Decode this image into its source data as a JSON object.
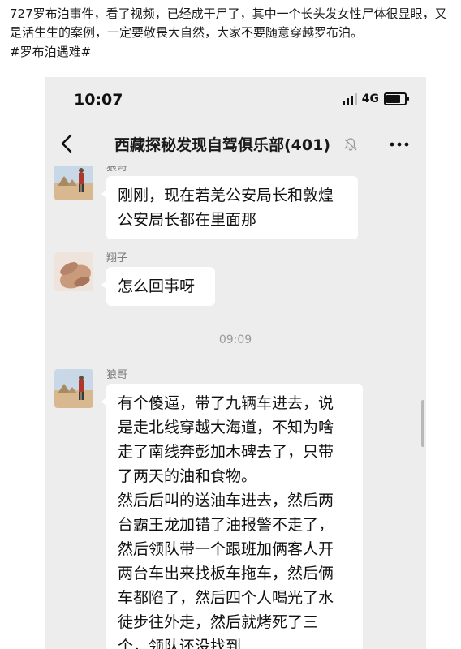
{
  "post": {
    "text": "727罗布泊事件，看了视频，已经成干尸了，其中一个长头发女性尸体很显眼，又是活生生的案例，一定要敬畏大自然，大家不要随意穿越罗布泊。",
    "hashtag": "#罗布泊遇难#"
  },
  "status_bar": {
    "time": "10:07",
    "network": "4G",
    "battery_level": 0.7
  },
  "chat": {
    "title": "西藏探秘发现自驾俱乐部(401)",
    "muted": true
  },
  "messages": [
    {
      "sender": "狼哥",
      "avatar": "person-in-desert-avatar",
      "lines": [
        "刚刚，现在若羌公安局长和敦煌",
        "公安局长都在里面那"
      ]
    },
    {
      "sender": "翔子",
      "avatar": "hand-photo-avatar",
      "lines": [
        "怎么回事呀"
      ]
    },
    {
      "timestamp": "09:09"
    },
    {
      "sender": "狼哥",
      "avatar": "person-in-desert-avatar",
      "lines": [
        "有个傻逼，带了九辆车进去，说",
        "是走北线穿越大海道，不知为啥",
        "走了南线奔彭加木碑去了，只带",
        "了两天的油和食物。",
        "然后后叫的送油车进去，然后两",
        "台霸王龙加错了油报警不走了，",
        "然后领队带一个跟班加俩客人开",
        "两台车出来找板车拖车，然后俩",
        "车都陷了，然后四个人喝光了水",
        "徒步往外走，然后就烤死了三",
        "个，领队还没找到……"
      ]
    }
  ],
  "colors": {
    "chat_background": "#ededed",
    "bubble": "#ffffff",
    "sender_name": "#7d7d7d"
  }
}
